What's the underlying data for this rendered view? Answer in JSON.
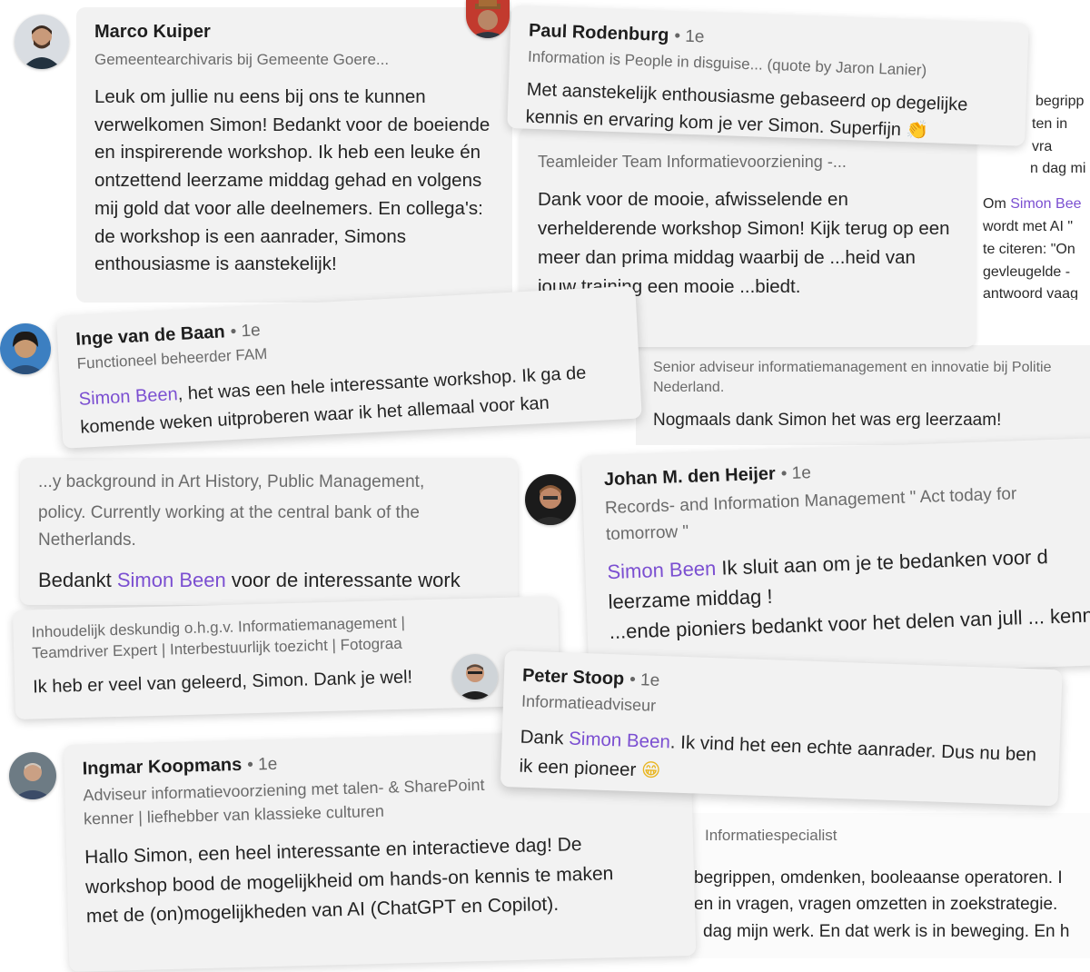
{
  "comments": {
    "marco": {
      "name": "Marco Kuiper",
      "headline": "Gemeentearchivaris bij Gemeente Goere...",
      "text": "Leuk om jullie nu eens bij ons te kunnen verwelkomen Simon! Bedankt voor de boeiende en inspirerende workshop. Ik heb een leuke én ontzettend leerzame middag gehad en volgens mij gold dat voor alle deelnemers. En collega's: de workshop is een aanrader, Simons enthousiasme is aanstekelijk!"
    },
    "paul": {
      "name": "Paul Rodenburg",
      "degree": "• 1e",
      "headline": "Information is People in disguise... (quote by Jaron Lanier)",
      "text": "Met aanstekelijk enthousiasme gebaseerd op degelijke kennis en ervaring kom je ver Simon. Superfijn",
      "emoji": "👏"
    },
    "teamleider": {
      "headline": "Teamleider Team Informatievoorziening -...",
      "text": "Dank voor de mooie, afwisselende en verhelderende workshop Simon! Kijk terug op een meer dan prima middag waarbij de ...heid van jouw training een mooie ...biedt."
    },
    "right_fragment": {
      "lines": [
        "begripp",
        "ten in vra",
        "n dag mi"
      ],
      "text_prefix": "Om ",
      "mention": "Simon Bee",
      "lines2": [
        "wordt met AI \"",
        "te citeren: \"On",
        "gevleugelde -",
        "antwoord vaag"
      ]
    },
    "inge": {
      "name": "Inge van de Baan",
      "degree": "• 1e",
      "headline": "Functioneel beheerder FAM",
      "mention": "Simon Been",
      "text": ", het was een hele interessante workshop. Ik ga de komende weken uitproberen waar ik het allemaal voor kan gebruiken en waar ik dingen kan verbeteren. Leuk!"
    },
    "senior": {
      "headline": "Senior adviseur informatiemanagement en innovatie bij Politie Nederland.",
      "text": "Nogmaals dank Simon het was erg leerzaam!"
    },
    "background": {
      "headline_top": "...y background in Art History, Public Management,",
      "headline": "policy. Currently working at the central bank of the Netherlands.",
      "text_prefix": "Bedankt ",
      "mention": "Simon Been",
      "text_suffix": " voor de interessante work"
    },
    "johan": {
      "name": "Johan M. den Heijer",
      "degree": "• 1e",
      "headline": "Records- and Information Management \" Act today for tomorrow \"",
      "mention": "Simon Been",
      "text": " Ik sluit aan om je te bedanken voor d leerzame middag !",
      "text2": "...ende pioniers bedankt voor het delen van jull ... kennis !"
    },
    "inhoudelijk": {
      "headline": "Inhoudelijk deskundig o.h.g.v. Informatiemanagement | Teamdriver Expert | Interbestuurlijk toezicht | Fotograa",
      "text": "Ik heb er veel van geleerd, Simon. Dank je wel!"
    },
    "peter": {
      "name": "Peter Stoop",
      "degree": "• 1e",
      "headline": "Informatieadviseur",
      "text_prefix": "Dank ",
      "mention": "Simon Been",
      "text": ". Ik vind het een echte aanrader. Dus nu ben ik een pioneer",
      "emoji": "😁"
    },
    "ingmar": {
      "name": "Ingmar Koopmans",
      "degree": "• 1e",
      "headline": "Adviseur informatievoorziening met talen- & SharePoint kenner | liefhebber van klassieke culturen",
      "text": "Hallo Simon, een heel interessante en interactieve dag! De workshop bood de mogelijkheid om hands-on kennis te maken met de (on)mogelijkheden van AI (ChatGPT en Copilot)."
    },
    "informatiespecialist": {
      "headline": "Informatiespecialist",
      "lines": [
        "begrippen, omdenken, booleaanse operatoren. I",
        "en in vragen, vragen omzetten in zoekstrategie.",
        "dag mijn werk. En dat werk is in beweging. En h"
      ]
    }
  },
  "colors": {
    "mention": "#7b4fd1",
    "card": "#f2f2f2"
  }
}
